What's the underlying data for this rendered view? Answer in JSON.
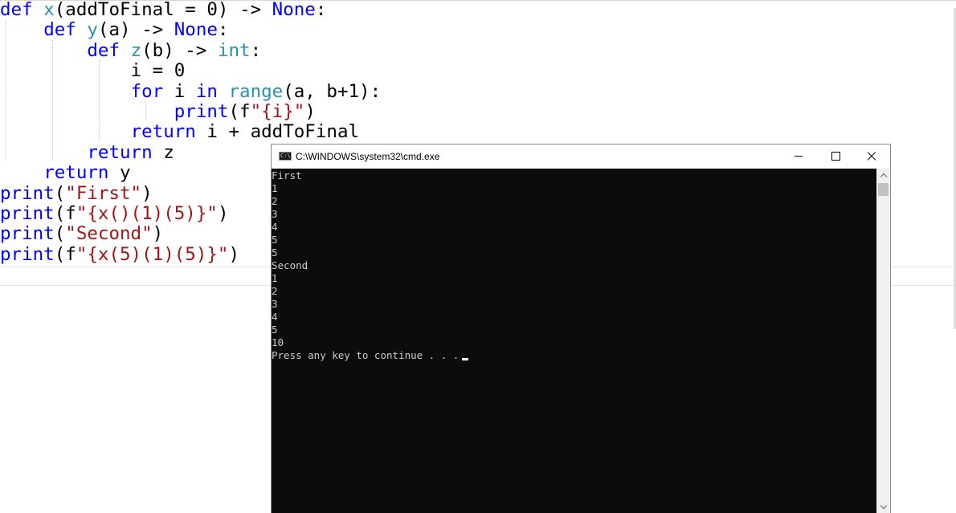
{
  "editor": {
    "lines": [
      [
        {
          "t": "def",
          "c": "kw"
        },
        {
          "t": " "
        },
        {
          "t": "x",
          "c": "fn"
        },
        {
          "t": "(addToFinal = 0) -> "
        },
        {
          "t": "None",
          "c": "kw"
        },
        {
          "t": ":"
        }
      ],
      [
        {
          "t": "    "
        },
        {
          "t": "def",
          "c": "kw"
        },
        {
          "t": " "
        },
        {
          "t": "y",
          "c": "fn"
        },
        {
          "t": "(a) -> "
        },
        {
          "t": "None",
          "c": "kw"
        },
        {
          "t": ":"
        }
      ],
      [
        {
          "t": "        "
        },
        {
          "t": "def",
          "c": "kw"
        },
        {
          "t": " "
        },
        {
          "t": "z",
          "c": "fn"
        },
        {
          "t": "(b) -> "
        },
        {
          "t": "int",
          "c": "bi"
        },
        {
          "t": ":"
        }
      ],
      [
        {
          "t": "            i = 0"
        }
      ],
      [
        {
          "t": "            "
        },
        {
          "t": "for",
          "c": "kw"
        },
        {
          "t": " i "
        },
        {
          "t": "in",
          "c": "kw"
        },
        {
          "t": " "
        },
        {
          "t": "range",
          "c": "bi"
        },
        {
          "t": "(a, b+1):"
        }
      ],
      [
        {
          "t": "                "
        },
        {
          "t": "print",
          "c": "kw"
        },
        {
          "t": "(f"
        },
        {
          "t": "\"{i}\"",
          "c": "str"
        },
        {
          "t": ")"
        }
      ],
      [
        {
          "t": "            "
        },
        {
          "t": "return",
          "c": "kw"
        },
        {
          "t": " i + addToFinal"
        }
      ],
      [
        {
          "t": "        "
        },
        {
          "t": "return",
          "c": "kw"
        },
        {
          "t": " z"
        }
      ],
      [
        {
          "t": "    "
        },
        {
          "t": "return",
          "c": "kw"
        },
        {
          "t": " y"
        }
      ],
      [
        {
          "t": "print",
          "c": "kw"
        },
        {
          "t": "("
        },
        {
          "t": "\"First\"",
          "c": "str"
        },
        {
          "t": ")"
        }
      ],
      [
        {
          "t": "print",
          "c": "kw"
        },
        {
          "t": "(f"
        },
        {
          "t": "\"{x()(1)(5)}\"",
          "c": "str"
        },
        {
          "t": ")"
        }
      ],
      [
        {
          "t": "print",
          "c": "kw"
        },
        {
          "t": "("
        },
        {
          "t": "\"Second\"",
          "c": "str"
        },
        {
          "t": ")"
        }
      ],
      [
        {
          "t": "print",
          "c": "kw"
        },
        {
          "t": "(f"
        },
        {
          "t": "\"{x(5)(1)(5)}\"",
          "c": "str"
        },
        {
          "t": ")"
        }
      ]
    ]
  },
  "console": {
    "title": "C:\\WINDOWS\\system32\\cmd.exe",
    "icon": "cmd-icon",
    "icon_text": "C:\\",
    "buttons": {
      "minimize": "minimize-icon",
      "maximize": "maximize-icon",
      "close": "close-icon"
    },
    "output": [
      "First",
      "1",
      "2",
      "3",
      "4",
      "5",
      "5",
      "Second",
      "1",
      "2",
      "3",
      "4",
      "5",
      "10"
    ],
    "prompt": "Press any key to continue . . ."
  },
  "colors": {
    "keyword": "#0000ff",
    "builtin": "#2b91af",
    "string": "#a31515",
    "console_bg": "#0c0c0c",
    "console_text": "#cccccc"
  }
}
